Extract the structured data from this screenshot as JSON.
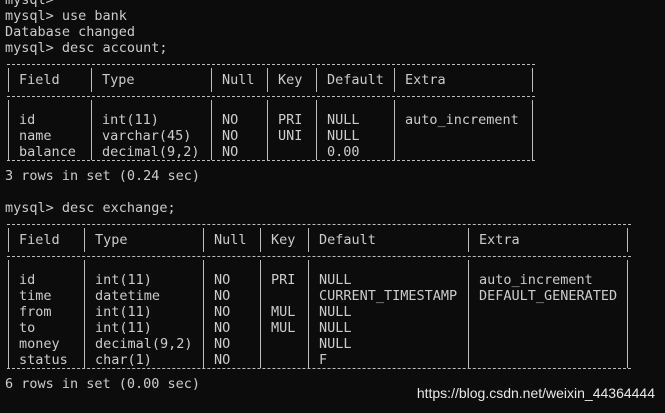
{
  "console": {
    "lines_top": [
      "mysql>",
      "mysql> use bank",
      "Database changed",
      "mysql> desc account;"
    ]
  },
  "table1": {
    "headers": [
      "Field",
      "Type",
      "Null",
      "Key",
      "Default",
      "Extra"
    ],
    "rows": [
      [
        "id",
        "int(11)",
        "NO",
        "PRI",
        "NULL",
        "auto_increment"
      ],
      [
        "name",
        "varchar(45)",
        "NO",
        "UNI",
        "NULL",
        ""
      ],
      [
        "balance",
        "decimal(9,2)",
        "NO",
        "",
        "0.00",
        ""
      ]
    ],
    "summary": "3 rows in set (0.24 sec)"
  },
  "prompt2": "mysql> desc exchange;",
  "table2": {
    "headers": [
      "Field",
      "Type",
      "Null",
      "Key",
      "Default",
      "Extra"
    ],
    "rows": [
      [
        "id",
        "int(11)",
        "NO",
        "PRI",
        "NULL",
        "auto_increment"
      ],
      [
        "time",
        "datetime",
        "NO",
        "",
        "CURRENT_TIMESTAMP",
        "DEFAULT_GENERATED"
      ],
      [
        "from",
        "int(11)",
        "NO",
        "MUL",
        "NULL",
        ""
      ],
      [
        "to",
        "int(11)",
        "NO",
        "MUL",
        "NULL",
        ""
      ],
      [
        "money",
        "decimal(9,2)",
        "NO",
        "",
        "NULL",
        ""
      ],
      [
        "status",
        "char(1)",
        "NO",
        "",
        "F",
        ""
      ]
    ],
    "summary": "6 rows in set (0.00 sec)"
  },
  "watermark": "https://blog.csdn.net/weixin_44364444",
  "colors": {
    "background": "#0c0c0c",
    "text": "#cccccc"
  }
}
